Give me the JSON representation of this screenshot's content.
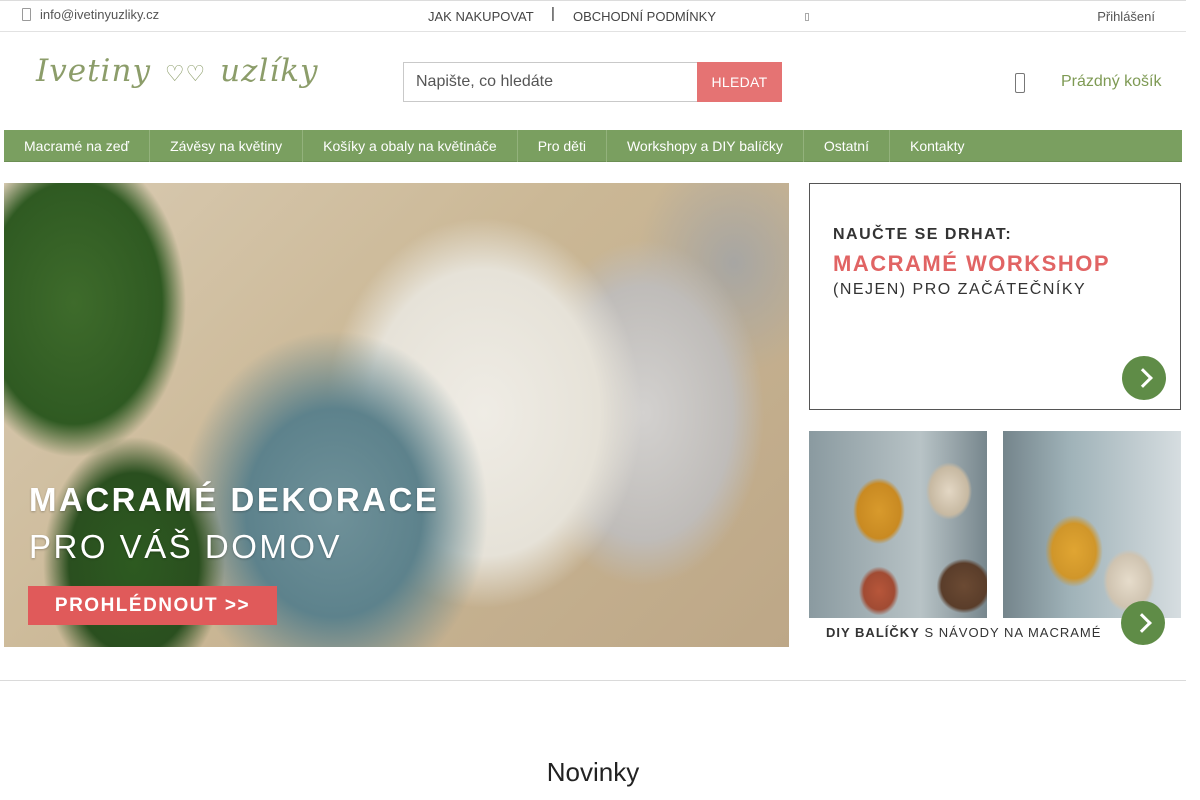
{
  "topbar": {
    "email": "info@ivetinyuzliky.cz",
    "links": [
      "JAK NAKUPOVAT",
      "OBCHODNÍ PODMÍNKY"
    ],
    "separator": "|",
    "login": "Přihlášení"
  },
  "header": {
    "logo": {
      "part1": "Ivetiny",
      "heart": "♡♡",
      "part2": "uzlíky"
    },
    "search_placeholder": "Napište, co hledáte",
    "search_button": "HLEDAT",
    "cart_text": "Prázdný košík"
  },
  "nav": {
    "items": [
      "Macramé na zeď",
      "Závěsy na květiny",
      "Košíky a obaly na květináče",
      "Pro děti",
      "Workshopy a DIY balíčky",
      "Ostatní",
      "Kontakty"
    ]
  },
  "hero": {
    "title1": "MACRAMÉ DEKORACE",
    "title2": "PRO VÁŠ DOMOV",
    "button": "PROHLÉDNOUT >>"
  },
  "promo_workshop": {
    "line1": "NAUČTE SE DRHAT:",
    "line2": "MACRAMÉ WORKSHOP",
    "line3": "(NEJEN) PRO ZAČÁTEČNÍKY"
  },
  "promo_diy": {
    "caption_bold": "DIY BALÍČKY",
    "caption_rest": " S NÁVODY NA MACRAMÉ"
  },
  "section": {
    "title": "Novinky"
  },
  "colors": {
    "nav_green": "#7a9f60",
    "accent_red": "#e57373",
    "cart_green": "#7e9a54",
    "arrow_green": "#5f8c47"
  },
  "icons": [
    "mail-icon",
    "cart-icon",
    "arrow-right-icon"
  ]
}
